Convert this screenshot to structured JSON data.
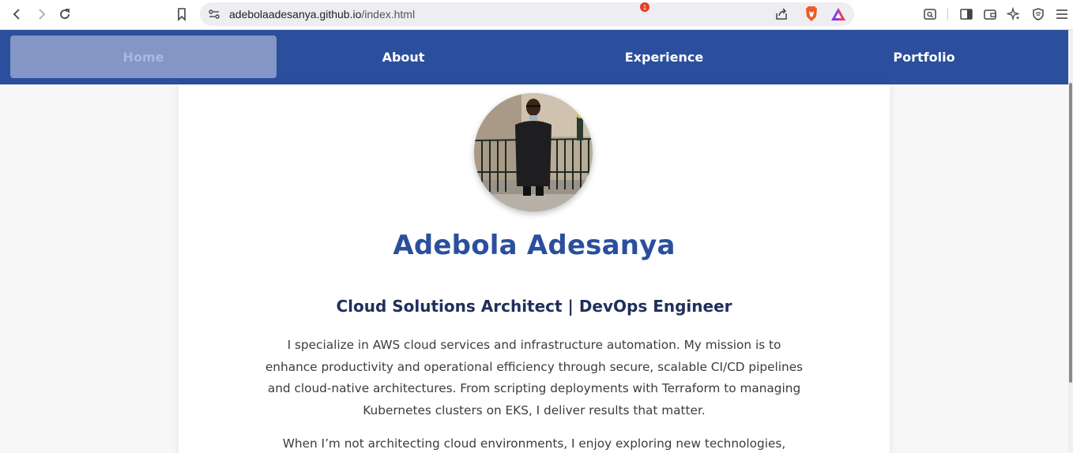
{
  "browser": {
    "url_host": "adebolaadesanya.github.io",
    "url_path": "/index.html",
    "rewards_badge": "1"
  },
  "nav": {
    "items": [
      {
        "label": "Home",
        "active": true
      },
      {
        "label": "About",
        "active": false
      },
      {
        "label": "Experience",
        "active": false
      },
      {
        "label": "Portfolio",
        "active": false
      }
    ]
  },
  "profile": {
    "name": "Adebola Adesanya",
    "role": "Cloud Solutions Architect | DevOps Engineer",
    "bio": "I specialize in AWS cloud services and infrastructure automation. My mission is to enhance productivity and operational efficiency through secure, scalable CI/CD pipelines and cloud-native architectures. From scripting deployments with Terraform to managing Kubernetes clusters on EKS, I deliver results that matter.",
    "bio2": "When I’m not architecting cloud environments, I enjoy exploring new technologies,"
  },
  "colors": {
    "nav_bg": "#2b4f9d",
    "name": "#2b4f9d",
    "role": "#1f2f5a",
    "text": "#3c3c3c"
  }
}
